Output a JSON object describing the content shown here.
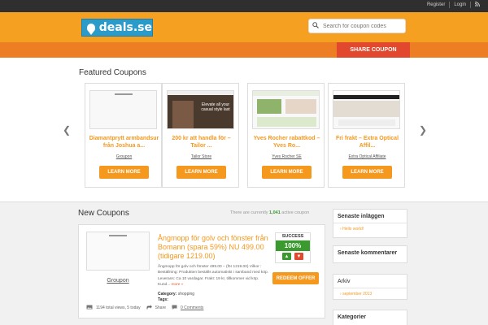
{
  "topbar": {
    "register": "Register",
    "login": "Login"
  },
  "logo": {
    "text": "deals.se"
  },
  "search": {
    "placeholder": "Search for coupon codes"
  },
  "share_button": "SHARE COUPON",
  "featured": {
    "heading": "Featured Coupons",
    "cards": [
      {
        "title": "Diamantprytt armbandsur från Joshua a...",
        "store": "Groupon",
        "button": "LEARN MORE"
      },
      {
        "title": "200 kr att handla för – Tailor ...",
        "store": "Tailor Store",
        "button": "LEARN MORE"
      },
      {
        "title": "Yves Rocher rabattkod – Yves Ro...",
        "store": "Yves Rocher SE",
        "button": "LEARN MORE"
      },
      {
        "title": "Fri frakt – Extra Optical Affil...",
        "store": "Extra Optical Affiliate",
        "button": "LEARN MORE"
      }
    ],
    "thumb2_text": "Elevate all your casual style last"
  },
  "new_coupons": {
    "heading": "New Coupons",
    "count_prefix": "There are currently",
    "count": "1,041",
    "count_suffix": "active coupon"
  },
  "coupon": {
    "store": "Groupon",
    "title": "Ångmopp för golv och fönster från Bomann (spara 59%) NU 499.00 (tidigare 1219.00)",
    "description": "Ångmopp för golv och fönster 499.00 – (för 1219.00) Vilkor : Beställning: Produkten beställs automatiskt i samband med köp. Leverans: Ca 10 vardagar. Frakt: 19 kr, tillkommer vid köp. Kund...",
    "more": "more »",
    "category_label": "Category:",
    "category": "shopping",
    "tags_label": "Tags:",
    "views": "1194 total views, 5 today",
    "share": "Share",
    "comments": "0 Comments",
    "success_label": "SUCCESS",
    "success_pct": "100%",
    "redeem": "REDEEM OFFER"
  },
  "sidebar": {
    "recent_posts_title": "Senaste inläggen",
    "recent_post": "Hello world!",
    "recent_comments_title": "Senaste kommentarer",
    "archive_title": "Arkiv",
    "archive_item": "september 2013",
    "categories_title": "Kategorier"
  },
  "colors": {
    "orange": "#f5a021",
    "accent": "#f5981e",
    "share": "#e2482d",
    "success": "#3a9a2f"
  }
}
